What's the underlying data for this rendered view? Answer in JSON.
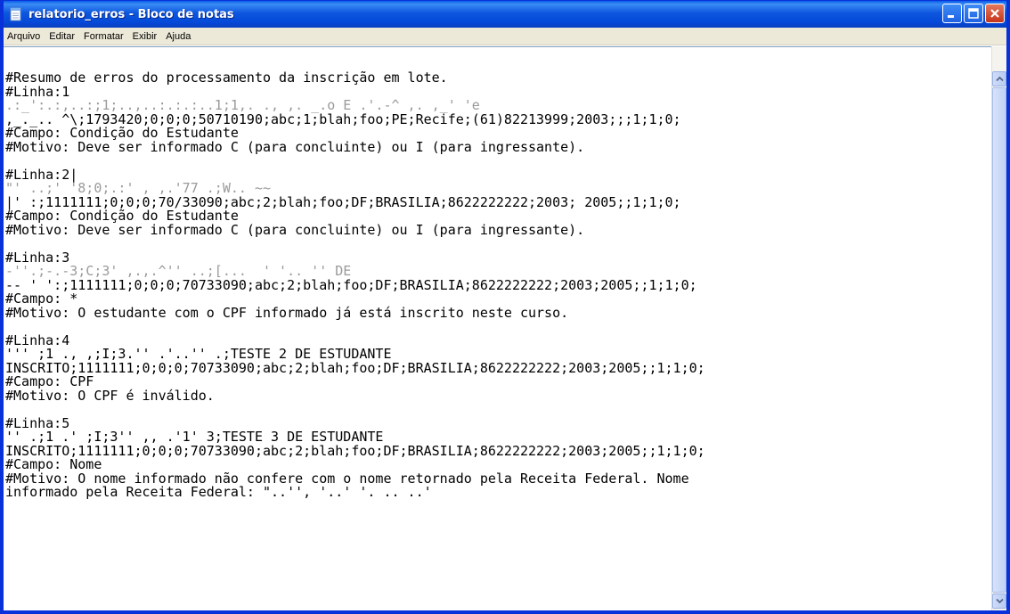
{
  "window": {
    "title": "relatorio_erros - Bloco de notas"
  },
  "menu": {
    "items": [
      "Arquivo",
      "Editar",
      "Formatar",
      "Exibir",
      "Ajuda"
    ]
  },
  "document": {
    "lines": [
      {
        "text": "#Resumo de erros do processamento da inscrição em lote."
      },
      {
        "text": "#Linha:1"
      },
      {
        "text": ".:_':.:,..:;1;..,..:.:.:..1;1,. ., ,. _.o E .'.-^ ,. ,_' 'e",
        "obscured": true
      },
      {
        "text": ",_._.. ^\\;1793420;0;0;0;50710190;abc;1;blah;foo;PE;Recife;(61)82213999;2003;;;1;1;0;"
      },
      {
        "text": "#Campo: Condição do Estudante"
      },
      {
        "text": "#Motivo: Deve ser informado C (para concluinte) ou I (para ingressante)."
      },
      {
        "text": ""
      },
      {
        "text": "#Linha:2|"
      },
      {
        "text": "\"' ..;' '8;0;.:' , ,.'77 .;W.. ~~",
        "obscured": true
      },
      {
        "text": "|' :;1111111;0;0;0;70/33090;abc;2;blah;foo;DF;BRASILIA;8622222222;2003; 2005;;1;1;0;"
      },
      {
        "text": "#Campo: Condição do Estudante"
      },
      {
        "text": "#Motivo: Deve ser informado C (para concluinte) ou I (para ingressante)."
      },
      {
        "text": ""
      },
      {
        "text": "#Linha:3"
      },
      {
        "text": "-''.;-.-3;C;3' ,.,.^'' ..;[...  ' '.. '' DE",
        "obscured": true
      },
      {
        "text": "-- ' ':;1111111;0;0;0;70733090;abc;2;blah;foo;DF;BRASILIA;8622222222;2003;2005;;1;1;0;"
      },
      {
        "text": "#Campo: *"
      },
      {
        "text": "#Motivo: O estudante com o CPF informado já está inscrito neste curso."
      },
      {
        "text": ""
      },
      {
        "text": "#Linha:4"
      },
      {
        "text": "''' ;1 ., ,;I;3.'' .'..'' .;TESTE 2 DE ESTUDANTE"
      },
      {
        "text": "INSCRITO;1111111;0;0;0;70733090;abc;2;blah;foo;DF;BRASILIA;8622222222;2003;2005;;1;1;0;"
      },
      {
        "text": "#Campo: CPF"
      },
      {
        "text": "#Motivo: O CPF é inválido."
      },
      {
        "text": ""
      },
      {
        "text": "#Linha:5"
      },
      {
        "text": "'' .;1 .' ;I;3'' ,, .'1' 3;TESTE 3 DE ESTUDANTE"
      },
      {
        "text": "INSCRITO;1111111;0;0;0;70733090;abc;2;blah;foo;DF;BRASILIA;8622222222;2003;2005;;1;1;0;"
      },
      {
        "text": "#Campo: Nome"
      },
      {
        "text": "#Motivo: O nome informado não confere com o nome retornado pela Receita Federal. Nome"
      },
      {
        "text": "informado pela Receita Federal: \"..'', '..' '. .. ..'"
      }
    ]
  },
  "colors": {
    "titlebar": "#0549d8",
    "menubar": "#ece9d8",
    "close_button": "#c4351a"
  },
  "icons": {
    "app": "notepad-icon",
    "minimize": "minimize-icon",
    "maximize": "maximize-icon",
    "close": "close-icon",
    "scroll_up": "arrow-up-icon",
    "scroll_down": "arrow-down-icon"
  }
}
